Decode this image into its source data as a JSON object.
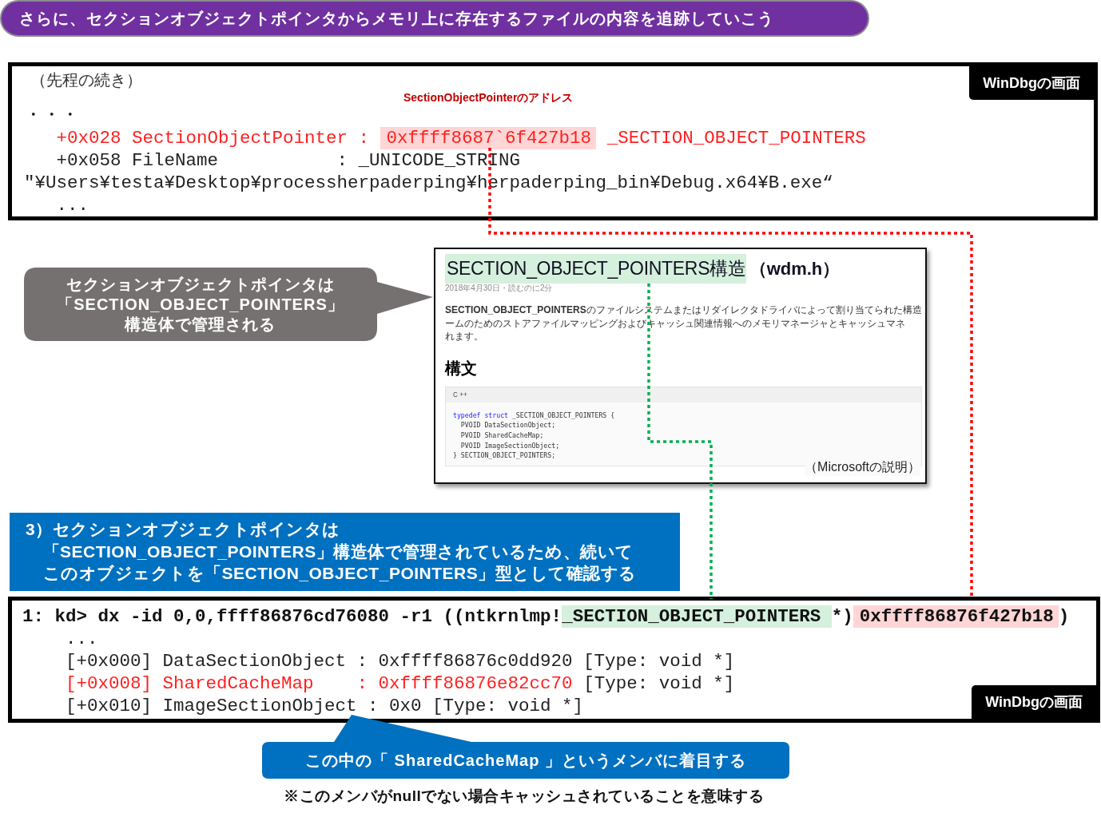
{
  "heading": "さらに、セクションオブジェクトポインタからメモリ上に存在するファイルの内容を追跡していこう",
  "panels": [
    {
      "badge": "WinDbgの画面",
      "intro": "（先程の続き）",
      "annotation": "SectionObjectPointerのアドレス",
      "lines": [
        {
          "kind": "output",
          "segments": [
            {
              "kind": "plain",
              "text": "・・・"
            }
          ]
        },
        {
          "kind": "output",
          "segments": [
            {
              "kind": "red",
              "text": "   +0x028 SectionObjectPointer : "
            },
            {
              "kind": "red-marked",
              "text": "0xffff8687`6f427b18"
            },
            {
              "kind": "red",
              "text": " _SECTION_OBJECT_POINTERS"
            }
          ]
        },
        {
          "kind": "output",
          "segments": [
            {
              "kind": "plain",
              "text": "   +0x058 FileName           : _UNICODE_STRING"
            }
          ]
        },
        {
          "kind": "output",
          "segments": [
            {
              "kind": "plain",
              "text": "\"¥Users¥testa¥Desktop¥processherpaderping¥herpaderping_bin¥Debug.x64¥B.exe“"
            }
          ]
        },
        {
          "kind": "output",
          "segments": [
            {
              "kind": "plain",
              "text": "   ..."
            }
          ]
        }
      ]
    },
    {
      "badge": "WinDbgの画面",
      "lines": [
        {
          "kind": "command",
          "segments": [
            {
              "kind": "plain",
              "text": "1: kd> dx -id 0,0,ffff86876cd76080 -r1 ((ntkrnlmp!"
            },
            {
              "kind": "green-mark",
              "text": "_SECTION_OBJECT_POINTERS "
            },
            {
              "kind": "plain",
              "text": "*)"
            },
            {
              "kind": "pink-mark",
              "text": "0xffff86876f427b18"
            },
            {
              "kind": "plain",
              "text": ")"
            }
          ]
        },
        {
          "kind": "output",
          "segments": [
            {
              "kind": "plain",
              "text": "    ..."
            }
          ]
        },
        {
          "kind": "output",
          "segments": [
            {
              "kind": "plain",
              "text": "    [+0x000] DataSectionObject : 0xffff86876c0dd920 [Type: void *]"
            }
          ]
        },
        {
          "kind": "output",
          "segments": [
            {
              "kind": "red",
              "text": "    [+0x008] SharedCacheMap    : 0xffff86876e82cc70"
            },
            {
              "kind": "plain",
              "text": " [Type: void *]"
            }
          ]
        },
        {
          "kind": "output",
          "segments": [
            {
              "kind": "plain",
              "text": "    [+0x010] ImageSectionObject : 0x0 [Type: void *]"
            }
          ]
        }
      ]
    }
  ],
  "struct_callout": {
    "lines": [
      "セクションオブジェクトポインタは",
      "「SECTION_OBJECT_POINTERS」",
      "構造体で管理される"
    ]
  },
  "doc": {
    "title": "SECTION_OBJECT_POINTERS構造",
    "title_suffix": "（wdm.h）",
    "meta": "2018年4月30日・読むのに2分",
    "description": [
      "**SECTION_OBJECT_POINTERS**のファイルシステムまたはリダイレクタドライバによって割り当てられた構造",
      "ームのためのストアファイルマッピングおよびキャッシュ関連情報へのメモリマネージャとキャッシュマネ",
      "れます。"
    ],
    "section": "構文",
    "language": "C ++",
    "code": [
      [
        {
          "kind": "keyword",
          "text": "typedef struct"
        },
        {
          "kind": "plain",
          "text": " _SECTION_OBJECT_POINTERS {"
        }
      ],
      [
        {
          "kind": "plain",
          "text": "  PVOID DataSectionObject;"
        }
      ],
      [
        {
          "kind": "plain",
          "text": "  PVOID SharedCacheMap;"
        }
      ],
      [
        {
          "kind": "plain",
          "text": "  PVOID ImageSectionObject;"
        }
      ],
      [
        {
          "kind": "plain",
          "text": "} SECTION_OBJECT_POINTERS;"
        }
      ]
    ],
    "caption": "（Microsoftの説明）"
  },
  "step": {
    "lines": [
      "3）セクションオブジェクトポインタは",
      "　「SECTION_OBJECT_POINTERS」構造体で管理されているため、続いて",
      "　このオブジェクトを「SECTION_OBJECT_POINTERS」型として確認する"
    ]
  },
  "focus_callout": {
    "text": "この中の「 SharedCacheMap 」というメンバに着目する"
  },
  "note": "※このメンバがnullでない場合キャッシュされていることを意味する"
}
